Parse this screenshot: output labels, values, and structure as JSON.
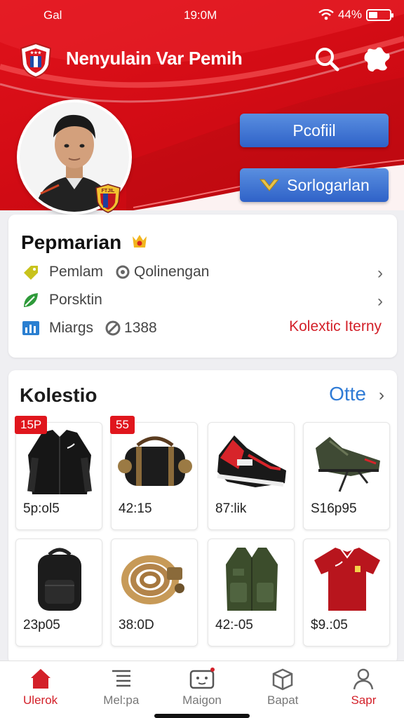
{
  "status_bar": {
    "carrier": "Gal",
    "time": "19:0M",
    "battery": "44%",
    "battery_level": 0.44
  },
  "header": {
    "title": "Nenyulain Var Pemih"
  },
  "profile": {
    "profile_button": "Pcofiil",
    "sort_button": "Sorlogarlan",
    "name": "Pepmarian",
    "crest_text": "FTJIL",
    "rows": [
      {
        "label": "Pemlam",
        "extra": "Qolinengan",
        "icon": "tag-icon"
      },
      {
        "label": "Porsktin",
        "icon": "leaf-icon"
      },
      {
        "label": "Miargs",
        "extra": "1388",
        "icon": "chart-icon"
      }
    ],
    "link": "Kolextic Iterny"
  },
  "collection": {
    "title": "Kolestio",
    "more": "Otte",
    "items": [
      {
        "price": "5p:ol5",
        "tag": "15P",
        "icon": "jacket-icon"
      },
      {
        "price": "42:15",
        "tag": "55",
        "icon": "duffel-bag-icon"
      },
      {
        "price": "87:lik",
        "tag": "",
        "icon": "red-shoe-icon"
      },
      {
        "price": "S16p95",
        "tag": "",
        "icon": "green-shoe-icon"
      },
      {
        "price": "23p05",
        "tag": "",
        "icon": "backpack-icon"
      },
      {
        "price": "38:0D",
        "tag": "",
        "icon": "rope-icon"
      },
      {
        "price": "42:-05",
        "tag": "",
        "icon": "vest-icon"
      },
      {
        "price": "$9.:05",
        "tag": "",
        "icon": "red-shirt-icon"
      }
    ]
  },
  "nav": {
    "tabs": [
      {
        "label": "Ulerok",
        "icon": "home-icon"
      },
      {
        "label": "Mel:pa",
        "icon": "list-icon"
      },
      {
        "label": "Maigon",
        "icon": "bot-icon"
      },
      {
        "label": "Bapat",
        "icon": "box-icon"
      },
      {
        "label": "Sapr",
        "icon": "user-icon"
      }
    ]
  },
  "colors": {
    "accent": "#d32029",
    "link_blue": "#2f7bd6",
    "button_blue": "#3a6fd0"
  }
}
